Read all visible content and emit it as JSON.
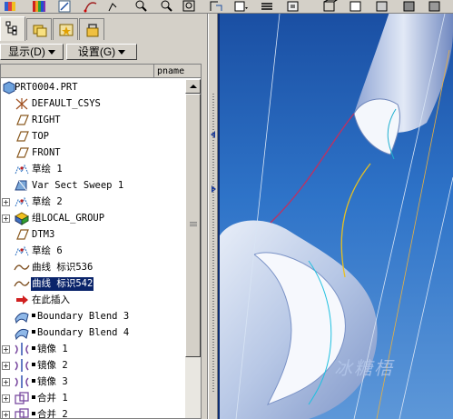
{
  "toolbar": {
    "icons": [
      "palette-icon",
      "color-icon",
      "sketch-icon",
      "curve-icon",
      "zoom-in-icon",
      "zoom-out-icon",
      "refit-icon",
      "orient-icon",
      "saved-views-icon",
      "layers-icon",
      "view-manager-icon",
      "display-style-icon"
    ]
  },
  "tabs": [
    "model-tree-tab",
    "folder-browser-tab",
    "favorites-tab",
    "connections-tab"
  ],
  "menus": {
    "display_label": "显示(D)",
    "settings_label": "设置(G)"
  },
  "tree": {
    "column_header": "pname",
    "root_label": "PRT0004.PRT",
    "items": [
      {
        "label": "DEFAULT_CSYS",
        "icon": "csys-icon",
        "expandable": false
      },
      {
        "label": "RIGHT",
        "icon": "datum-plane-icon",
        "expandable": false
      },
      {
        "label": "TOP",
        "icon": "datum-plane-icon",
        "expandable": false
      },
      {
        "label": "FRONT",
        "icon": "datum-plane-icon",
        "expandable": false
      },
      {
        "label": "草绘 1",
        "icon": "sketch-icon",
        "expandable": false
      },
      {
        "label": "Var Sect Sweep 1",
        "icon": "sweep-icon",
        "expandable": false
      },
      {
        "label": "草绘 2",
        "icon": "sketch-icon",
        "expandable": true
      },
      {
        "label": "组LOCAL_GROUP",
        "icon": "group-icon",
        "expandable": true
      },
      {
        "label": "DTM3",
        "icon": "datum-plane-icon",
        "expandable": false
      },
      {
        "label": "草绘 6",
        "icon": "sketch-icon",
        "expandable": false
      },
      {
        "label": "曲线 标识536",
        "icon": "curve-icon",
        "expandable": false
      },
      {
        "label": "曲线 标识542",
        "icon": "curve-icon",
        "expandable": false,
        "selected": true
      },
      {
        "label": "在此插入",
        "icon": "insert-here-icon",
        "expandable": false
      },
      {
        "label": "Boundary Blend 3",
        "icon": "boundary-blend-icon",
        "expandable": false,
        "marked": true
      },
      {
        "label": "Boundary Blend 4",
        "icon": "boundary-blend-icon",
        "expandable": false,
        "marked": true
      },
      {
        "label": "镜像 1",
        "icon": "mirror-icon",
        "expandable": true,
        "marked": true
      },
      {
        "label": "镜像 2",
        "icon": "mirror-icon",
        "expandable": true,
        "marked": true
      },
      {
        "label": "镜像 3",
        "icon": "mirror-icon",
        "expandable": true,
        "marked": true
      },
      {
        "label": "合并 1",
        "icon": "merge-icon",
        "expandable": true,
        "marked": true
      },
      {
        "label": "合并 2",
        "icon": "merge-icon",
        "expandable": true,
        "marked": true
      }
    ]
  },
  "viewport": {
    "watermark": "冰糖梧",
    "background_top": "#1a4fa3",
    "background_bottom": "#5d97d8"
  }
}
